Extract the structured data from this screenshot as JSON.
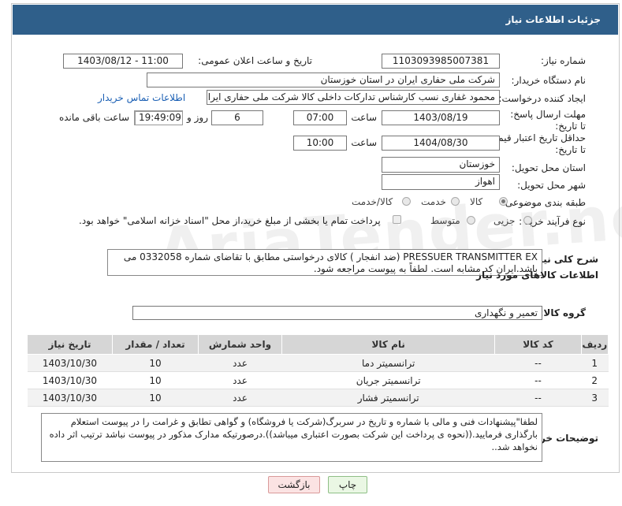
{
  "header": {
    "title": "جزئیات اطلاعات نیاز"
  },
  "fields": {
    "need_number_label": "شماره نیاز:",
    "need_number": "1103093985007381",
    "announce_label": "تاریخ و ساعت اعلان عمومی:",
    "announce_value": "1403/08/12 - 11:00",
    "buyer_org_label": "نام دستگاه خریدار:",
    "buyer_org": "شرکت ملی حفاری ایران در استان خوزستان",
    "requester_label": "ایجاد کننده درخواست:",
    "requester": "محمود غفاری نسب کارشناس تدارکات داخلی  کالا شرکت ملی حفاری ایران در",
    "contact_link": "اطلاعات تماس خریدار",
    "reply_deadline_label": "مهلت ارسال پاسخ: تا تاریخ:",
    "reply_date": "1403/08/19",
    "time_label": "ساعت",
    "reply_time": "07:00",
    "days_count": "6",
    "days_label": "روز و",
    "remaining_time": "19:49:09",
    "remaining_label": "ساعت باقی مانده",
    "price_validity_label": "حداقل تاریخ اعتبار قیمت: تا تاریخ:",
    "validity_date": "1404/08/30",
    "validity_time_label": "ساعت",
    "validity_time": "10:00",
    "province_label": "استان محل تحویل:",
    "province": "خوزستان",
    "city_label": "شهر محل تحویل:",
    "city": "اهواز",
    "category_label": "طبقه بندی موضوعی:",
    "category_options": [
      "کالا",
      "خدمت",
      "کالا/خدمت"
    ],
    "purchase_type_label": "نوع فرآیند خرید :",
    "purchase_options": [
      "جزیی",
      "متوسط"
    ],
    "payment_note": "پرداخت تمام یا بخشی از مبلغ خرید،از محل \"اسناد خزانه اسلامی\" خواهد بود.",
    "summary_label": "شرح کلی نیاز:",
    "summary_text": "PRESSUER TRANSMITTER EX (ضد انفجار ) کالای درخواستی مطابق با تقاضای شماره  0332058 می باشد.ایران کد مشابه است. لطفاً به پیوست مراجعه شود."
  },
  "goods": {
    "section_title": "اطلاعات کالاهای مورد نیاز",
    "group_label": "گروه کالا:",
    "group_value": "تعمیر و نگهداری",
    "columns": [
      "ردیف",
      "کد کالا",
      "نام کالا",
      "واحد شمارش",
      "تعداد / مقدار",
      "تاریخ نیاز"
    ],
    "rows": [
      {
        "idx": "1",
        "code": "--",
        "name": "ترانسمیتر دما",
        "unit": "عدد",
        "qty": "10",
        "date": "1403/10/30"
      },
      {
        "idx": "2",
        "code": "--",
        "name": "ترانسمیتر جریان",
        "unit": "عدد",
        "qty": "10",
        "date": "1403/10/30"
      },
      {
        "idx": "3",
        "code": "--",
        "name": "ترانسمیتر فشار",
        "unit": "عدد",
        "qty": "10",
        "date": "1403/10/30"
      }
    ]
  },
  "buyer_notes": {
    "label": "توضیحات خریدار:",
    "text": "لطفا\"پیشنهادات فنی و مالی با شماره و تاریخ در سربرگ(شرکت یا فروشگاه) و گواهی تطابق و غرامت را در پیوست استعلام بارگذاری فرمایید.((نحوه ی پرداخت این شرکت بصورت اعتباری میباشد)).درصورتیکه مدارک مذکور در پیوست نباشد ترتیب اثر داده نخواهد شد.."
  },
  "buttons": {
    "print": "چاپ",
    "back": "بازگشت"
  },
  "watermark": "AriaTender.neT"
}
